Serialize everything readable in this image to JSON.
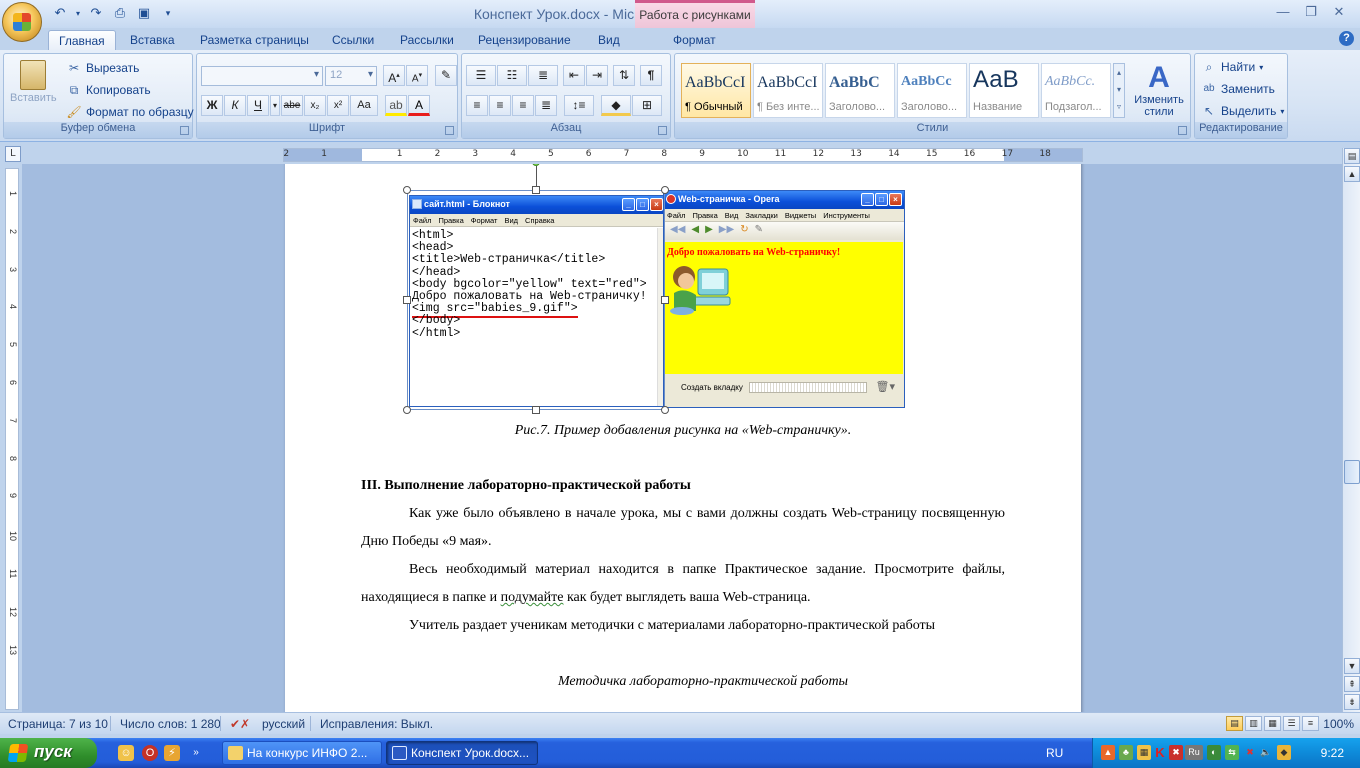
{
  "window": {
    "title": "Конспект Урок.docx - Microsoft Word",
    "context_tab_group": "Работа с рисунками"
  },
  "tabs": [
    "Главная",
    "Вставка",
    "Разметка страницы",
    "Ссылки",
    "Рассылки",
    "Рецензирование",
    "Вид",
    "Формат"
  ],
  "ribbon": {
    "clipboard": {
      "label": "Буфер обмена",
      "paste": "Вставить",
      "cut": "Вырезать",
      "copy": "Копировать",
      "format_painter": "Формат по образцу"
    },
    "font": {
      "label": "Шрифт",
      "font_name": "",
      "font_size": "12",
      "bold": "Ж",
      "italic": "К",
      "underline": "Ч",
      "strike": "abe",
      "subscript": "x₂",
      "superscript": "x²",
      "change_case": "Aa"
    },
    "paragraph": {
      "label": "Абзац"
    },
    "styles": {
      "label": "Стили",
      "items": [
        {
          "sample": "AaBbCcI",
          "name": "¶ Обычный"
        },
        {
          "sample": "AaBbCcI",
          "name": "¶ Без инте..."
        },
        {
          "sample": "AaBbC",
          "name": "Заголово..."
        },
        {
          "sample": "AaBbCc",
          "name": "Заголово..."
        },
        {
          "sample": "АаВ",
          "name": "Название"
        },
        {
          "sample": "AaBbCc.",
          "name": "Подзагол..."
        }
      ],
      "change_styles": "Изменить стили"
    },
    "editing": {
      "label": "Редактирование",
      "find": "Найти",
      "replace": "Заменить",
      "select": "Выделить"
    }
  },
  "ruler": {
    "numbers": [
      "2",
      "1",
      "1",
      "2",
      "3",
      "4",
      "5",
      "6",
      "7",
      "8",
      "9",
      "10",
      "11",
      "12",
      "13",
      "14",
      "15",
      "16",
      "17",
      "18"
    ],
    "vertical_numbers": [
      "1",
      "2",
      "3",
      "4",
      "5",
      "6",
      "7",
      "8",
      "9",
      "10",
      "11",
      "12",
      "13"
    ]
  },
  "figure": {
    "notepad": {
      "title": "сайт.html - Блокнот",
      "menu": [
        "Файл",
        "Правка",
        "Формат",
        "Вид",
        "Справка"
      ],
      "lines": [
        "<html>",
        "<head>",
        "<title>Web-страничка</title>",
        "</head>",
        "<body bgcolor=\"yellow\" text=\"red\">",
        "Добро пожаловать на Web-страничку!",
        "<img src=\"babies_9.gif\">",
        "</body>",
        "</html>"
      ]
    },
    "opera": {
      "title": "Web-страничка - Opera",
      "menu": [
        "Файл",
        "Правка",
        "Вид",
        "Закладки",
        "Виджеты",
        "Инструменты"
      ],
      "welcome_text": "Добро пожаловать на Web-страничку!",
      "status_text": "Создать вкладку"
    }
  },
  "document": {
    "caption": "Рис.7. Пример добавления рисунка  на «Web-страничку».",
    "heading": "III. Выполнение лабораторно-практической работы",
    "paragraphs": [
      "Как уже было объявлено в начале урока, мы с вами должны создать Web-страницу посвященную Дню Победы «9 мая».",
      "Учитель раздает ученикам методички с материалами лабораторно-практической работы"
    ],
    "para2_part1": "Весь необходимый материал находится в папке Практическое задание. Просмотрите файлы, находящиеся в папке и ",
    "para2_wavy": "подумайте",
    "para2_part2": " как будет выглядеть ваша Web-страница.",
    "subtitle": "Методичка лабораторно-практической работы"
  },
  "statusbar": {
    "page": "Страница: 7 из 10",
    "words": "Число слов: 1 280",
    "language": "русский",
    "track_changes": "Исправления: Выкл.",
    "zoom": "100%"
  },
  "taskbar": {
    "start": "пуск",
    "tasks": [
      "На конкурс ИНФО 2...",
      "Конспект Урок.docx..."
    ],
    "language": "RU",
    "tray_lang": "Ru",
    "clock": "9:22"
  }
}
